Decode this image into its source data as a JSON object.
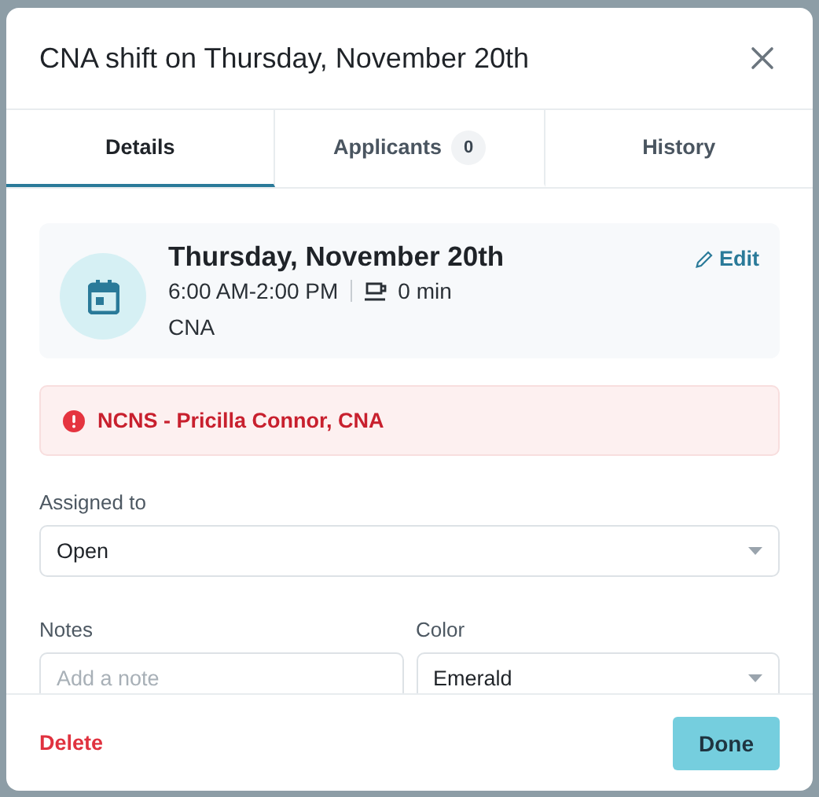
{
  "dialog": {
    "title": "CNA shift on Thursday, November 20th"
  },
  "tabs": [
    {
      "label": "Details",
      "selected": true
    },
    {
      "label": "Applicants",
      "count": "0",
      "selected": false
    },
    {
      "label": "History",
      "selected": false
    }
  ],
  "shift": {
    "date": "Thursday, November 20th",
    "time": "6:00 AM-2:00 PM",
    "break": "0 min",
    "role": "CNA",
    "edit": "Edit"
  },
  "alert": {
    "text": "NCNS - Pricilla Connor, CNA"
  },
  "assigned": {
    "label": "Assigned to",
    "value": "Open"
  },
  "notes": {
    "label": "Notes",
    "placeholder": "Add a note"
  },
  "color": {
    "label": "Color",
    "value": "Emerald"
  },
  "footer": {
    "delete": "Delete",
    "done": "Done"
  }
}
